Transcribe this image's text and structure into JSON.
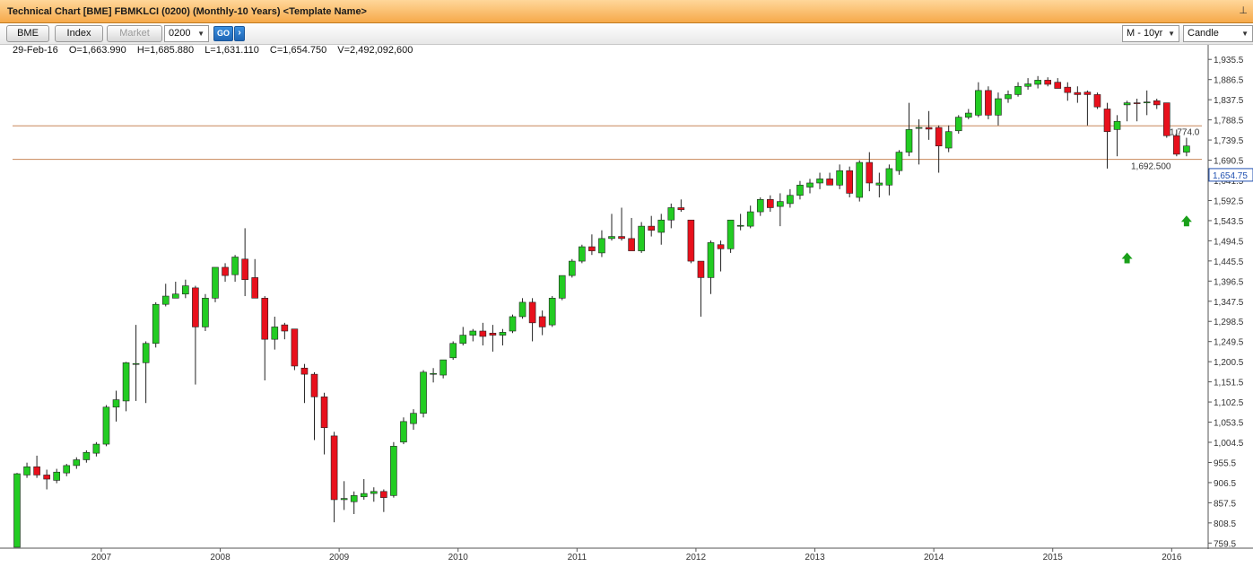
{
  "window": {
    "title": "Technical Chart [BME] FBMKLCI (0200) (Monthly-10 Years) <Template Name>",
    "pin_icon": "pin-icon"
  },
  "toolbar": {
    "bme_label": "BME",
    "index_label": "Index",
    "market_label": "Market",
    "code_value": "0200",
    "go_label": "GO",
    "next_label": "›",
    "period_value": "M - 10yr",
    "chart_type_value": "Candle"
  },
  "ohlc": {
    "date": "29-Feb-16",
    "open": "O=1,663.990",
    "high": "H=1,685.880",
    "low": "L=1,631.110",
    "close": "C=1,654.750",
    "volume": "V=2,492,092,600"
  },
  "colors": {
    "up": "#22cc22",
    "down": "#e8101c",
    "hline": "#c8875a",
    "arrow": "#1aa01a"
  },
  "chart_data": {
    "type": "candlestick",
    "interval": "monthly",
    "x_labels": [
      "2007",
      "2008",
      "2009",
      "2010",
      "2011",
      "2012",
      "2013",
      "2014",
      "2015",
      "2016"
    ],
    "y_ticks": [
      "1,935.5",
      "1,886.5",
      "1,837.5",
      "1,788.5",
      "1,739.5",
      "1,690.5",
      "1,641.5",
      "1,592.5",
      "1,543.5",
      "1,494.5",
      "1,445.5",
      "1,396.5",
      "1,347.5",
      "1,298.5",
      "1,249.5",
      "1,200.5",
      "1,151.5",
      "1,102.5",
      "1,053.5",
      "1,004.5",
      "955.5",
      "906.5",
      "857.5",
      "808.5",
      "759.5"
    ],
    "ylim": [
      710,
      1960
    ],
    "price_label": "1,654.75",
    "horizontal_lines": [
      {
        "value": 1774.0,
        "label": "1,774.0"
      },
      {
        "value": 1692.5,
        "label": "1,692.500"
      }
    ],
    "arrows": [
      {
        "date": "2015-08",
        "value": 1455,
        "direction": "up"
      },
      {
        "date": "2016-02",
        "value": 1545,
        "direction": "up"
      }
    ],
    "candles": [
      {
        "d": "2006-04",
        "o": 715,
        "h": 930,
        "l": 710,
        "c": 928
      },
      {
        "d": "2006-05",
        "o": 925,
        "h": 955,
        "l": 918,
        "c": 945
      },
      {
        "d": "2006-06",
        "o": 945,
        "h": 972,
        "l": 918,
        "c": 925
      },
      {
        "d": "2006-07",
        "o": 925,
        "h": 938,
        "l": 890,
        "c": 915
      },
      {
        "d": "2006-08",
        "o": 912,
        "h": 940,
        "l": 905,
        "c": 932
      },
      {
        "d": "2006-09",
        "o": 930,
        "h": 952,
        "l": 922,
        "c": 948
      },
      {
        "d": "2006-10",
        "o": 948,
        "h": 968,
        "l": 940,
        "c": 962
      },
      {
        "d": "2006-11",
        "o": 962,
        "h": 985,
        "l": 955,
        "c": 980
      },
      {
        "d": "2006-12",
        "o": 978,
        "h": 1005,
        "l": 970,
        "c": 1000
      },
      {
        "d": "2007-01",
        "o": 1000,
        "h": 1095,
        "l": 995,
        "c": 1090
      },
      {
        "d": "2007-02",
        "o": 1090,
        "h": 1130,
        "l": 1055,
        "c": 1108
      },
      {
        "d": "2007-03",
        "o": 1105,
        "h": 1200,
        "l": 1080,
        "c": 1198
      },
      {
        "d": "2007-04",
        "o": 1196,
        "h": 1290,
        "l": 1105,
        "c": 1196
      },
      {
        "d": "2007-05",
        "o": 1198,
        "h": 1250,
        "l": 1100,
        "c": 1245
      },
      {
        "d": "2007-06",
        "o": 1245,
        "h": 1345,
        "l": 1235,
        "c": 1340
      },
      {
        "d": "2007-07",
        "o": 1340,
        "h": 1390,
        "l": 1335,
        "c": 1360
      },
      {
        "d": "2007-08",
        "o": 1355,
        "h": 1395,
        "l": 1355,
        "c": 1365
      },
      {
        "d": "2007-09",
        "o": 1365,
        "h": 1400,
        "l": 1355,
        "c": 1385
      },
      {
        "d": "2007-10",
        "o": 1380,
        "h": 1385,
        "l": 1145,
        "c": 1285
      },
      {
        "d": "2007-11",
        "o": 1285,
        "h": 1365,
        "l": 1275,
        "c": 1355
      },
      {
        "d": "2007-12",
        "o": 1355,
        "h": 1430,
        "l": 1345,
        "c": 1430
      },
      {
        "d": "2008-01",
        "o": 1430,
        "h": 1440,
        "l": 1395,
        "c": 1410
      },
      {
        "d": "2008-02",
        "o": 1412,
        "h": 1460,
        "l": 1395,
        "c": 1455
      },
      {
        "d": "2008-03",
        "o": 1450,
        "h": 1525,
        "l": 1360,
        "c": 1400
      },
      {
        "d": "2008-04",
        "o": 1405,
        "h": 1450,
        "l": 1375,
        "c": 1355
      },
      {
        "d": "2008-05",
        "o": 1355,
        "h": 1360,
        "l": 1155,
        "c": 1255
      },
      {
        "d": "2008-06",
        "o": 1255,
        "h": 1310,
        "l": 1230,
        "c": 1285
      },
      {
        "d": "2008-07",
        "o": 1290,
        "h": 1295,
        "l": 1255,
        "c": 1275
      },
      {
        "d": "2008-08",
        "o": 1280,
        "h": 1275,
        "l": 1180,
        "c": 1190
      },
      {
        "d": "2008-09",
        "o": 1185,
        "h": 1195,
        "l": 1100,
        "c": 1170
      },
      {
        "d": "2008-10",
        "o": 1170,
        "h": 1175,
        "l": 1010,
        "c": 1115
      },
      {
        "d": "2008-11",
        "o": 1115,
        "h": 1125,
        "l": 975,
        "c": 1040
      },
      {
        "d": "2008-12",
        "o": 1020,
        "h": 1030,
        "l": 810,
        "c": 865
      },
      {
        "d": "2009-01",
        "o": 865,
        "h": 910,
        "l": 840,
        "c": 868
      },
      {
        "d": "2009-02",
        "o": 860,
        "h": 885,
        "l": 830,
        "c": 875
      },
      {
        "d": "2009-03",
        "o": 872,
        "h": 915,
        "l": 865,
        "c": 880
      },
      {
        "d": "2009-04",
        "o": 880,
        "h": 895,
        "l": 860,
        "c": 885
      },
      {
        "d": "2009-05",
        "o": 885,
        "h": 890,
        "l": 835,
        "c": 870
      },
      {
        "d": "2009-06",
        "o": 875,
        "h": 1005,
        "l": 870,
        "c": 995
      },
      {
        "d": "2009-07",
        "o": 1005,
        "h": 1065,
        "l": 1000,
        "c": 1055
      },
      {
        "d": "2009-08",
        "o": 1050,
        "h": 1085,
        "l": 1035,
        "c": 1075
      },
      {
        "d": "2009-09",
        "o": 1075,
        "h": 1180,
        "l": 1065,
        "c": 1175
      },
      {
        "d": "2009-10",
        "o": 1170,
        "h": 1185,
        "l": 1150,
        "c": 1172
      },
      {
        "d": "2009-11",
        "o": 1168,
        "h": 1205,
        "l": 1160,
        "c": 1205
      },
      {
        "d": "2009-12",
        "o": 1210,
        "h": 1250,
        "l": 1205,
        "c": 1245
      },
      {
        "d": "2010-01",
        "o": 1245,
        "h": 1285,
        "l": 1240,
        "c": 1265
      },
      {
        "d": "2010-02",
        "o": 1265,
        "h": 1280,
        "l": 1250,
        "c": 1275
      },
      {
        "d": "2010-03",
        "o": 1275,
        "h": 1295,
        "l": 1240,
        "c": 1262
      },
      {
        "d": "2010-04",
        "o": 1270,
        "h": 1290,
        "l": 1225,
        "c": 1265
      },
      {
        "d": "2010-05",
        "o": 1265,
        "h": 1280,
        "l": 1240,
        "c": 1272
      },
      {
        "d": "2010-06",
        "o": 1275,
        "h": 1315,
        "l": 1270,
        "c": 1310
      },
      {
        "d": "2010-07",
        "o": 1310,
        "h": 1355,
        "l": 1305,
        "c": 1345
      },
      {
        "d": "2010-08",
        "o": 1345,
        "h": 1355,
        "l": 1250,
        "c": 1295
      },
      {
        "d": "2010-09",
        "o": 1310,
        "h": 1325,
        "l": 1265,
        "c": 1285
      },
      {
        "d": "2010-10",
        "o": 1290,
        "h": 1360,
        "l": 1285,
        "c": 1355
      },
      {
        "d": "2010-11",
        "o": 1355,
        "h": 1410,
        "l": 1350,
        "c": 1410
      },
      {
        "d": "2010-12",
        "o": 1410,
        "h": 1450,
        "l": 1405,
        "c": 1445
      },
      {
        "d": "2011-01",
        "o": 1445,
        "h": 1485,
        "l": 1440,
        "c": 1480
      },
      {
        "d": "2011-02",
        "o": 1480,
        "h": 1510,
        "l": 1460,
        "c": 1470
      },
      {
        "d": "2011-03",
        "o": 1465,
        "h": 1520,
        "l": 1455,
        "c": 1500
      },
      {
        "d": "2011-04",
        "o": 1500,
        "h": 1560,
        "l": 1495,
        "c": 1505
      },
      {
        "d": "2011-05",
        "o": 1505,
        "h": 1575,
        "l": 1495,
        "c": 1500
      },
      {
        "d": "2011-06",
        "o": 1500,
        "h": 1550,
        "l": 1475,
        "c": 1470
      },
      {
        "d": "2011-07",
        "o": 1470,
        "h": 1540,
        "l": 1465,
        "c": 1530
      },
      {
        "d": "2011-08",
        "o": 1530,
        "h": 1555,
        "l": 1505,
        "c": 1520
      },
      {
        "d": "2011-09",
        "o": 1515,
        "h": 1560,
        "l": 1485,
        "c": 1545
      },
      {
        "d": "2011-10",
        "o": 1545,
        "h": 1585,
        "l": 1525,
        "c": 1575
      },
      {
        "d": "2011-11",
        "o": 1575,
        "h": 1595,
        "l": 1565,
        "c": 1570
      },
      {
        "d": "2011-12",
        "o": 1545,
        "h": 1545,
        "l": 1440,
        "c": 1445
      },
      {
        "d": "2012-01",
        "o": 1445,
        "h": 1445,
        "l": 1310,
        "c": 1405
      },
      {
        "d": "2012-02",
        "o": 1405,
        "h": 1495,
        "l": 1365,
        "c": 1490
      },
      {
        "d": "2012-03",
        "o": 1485,
        "h": 1495,
        "l": 1420,
        "c": 1475
      },
      {
        "d": "2012-04",
        "o": 1475,
        "h": 1545,
        "l": 1465,
        "c": 1545
      },
      {
        "d": "2012-05",
        "o": 1530,
        "h": 1560,
        "l": 1520,
        "c": 1532
      },
      {
        "d": "2012-06",
        "o": 1530,
        "h": 1580,
        "l": 1525,
        "c": 1565
      },
      {
        "d": "2012-07",
        "o": 1565,
        "h": 1600,
        "l": 1555,
        "c": 1595
      },
      {
        "d": "2012-08",
        "o": 1595,
        "h": 1605,
        "l": 1565,
        "c": 1575
      },
      {
        "d": "2012-09",
        "o": 1578,
        "h": 1610,
        "l": 1530,
        "c": 1590
      },
      {
        "d": "2012-10",
        "o": 1585,
        "h": 1620,
        "l": 1575,
        "c": 1605
      },
      {
        "d": "2012-11",
        "o": 1605,
        "h": 1640,
        "l": 1595,
        "c": 1630
      },
      {
        "d": "2012-12",
        "o": 1625,
        "h": 1645,
        "l": 1610,
        "c": 1635
      },
      {
        "d": "2013-01",
        "o": 1635,
        "h": 1660,
        "l": 1620,
        "c": 1645
      },
      {
        "d": "2013-02",
        "o": 1645,
        "h": 1660,
        "l": 1635,
        "c": 1630
      },
      {
        "d": "2013-03",
        "o": 1630,
        "h": 1680,
        "l": 1620,
        "c": 1665
      },
      {
        "d": "2013-04",
        "o": 1665,
        "h": 1675,
        "l": 1600,
        "c": 1610
      },
      {
        "d": "2013-05",
        "o": 1600,
        "h": 1690,
        "l": 1590,
        "c": 1685
      },
      {
        "d": "2013-06",
        "o": 1685,
        "h": 1710,
        "l": 1615,
        "c": 1635
      },
      {
        "d": "2013-07",
        "o": 1630,
        "h": 1660,
        "l": 1600,
        "c": 1635
      },
      {
        "d": "2013-08",
        "o": 1630,
        "h": 1680,
        "l": 1605,
        "c": 1670
      },
      {
        "d": "2013-09",
        "o": 1665,
        "h": 1715,
        "l": 1655,
        "c": 1710
      },
      {
        "d": "2013-10",
        "o": 1710,
        "h": 1830,
        "l": 1700,
        "c": 1765
      },
      {
        "d": "2013-11",
        "o": 1770,
        "h": 1790,
        "l": 1680,
        "c": 1770
      },
      {
        "d": "2013-12",
        "o": 1770,
        "h": 1810,
        "l": 1740,
        "c": 1766
      },
      {
        "d": "2014-01",
        "o": 1770,
        "h": 1775,
        "l": 1660,
        "c": 1725
      },
      {
        "d": "2014-02",
        "o": 1720,
        "h": 1775,
        "l": 1710,
        "c": 1760
      },
      {
        "d": "2014-03",
        "o": 1762,
        "h": 1800,
        "l": 1755,
        "c": 1795
      },
      {
        "d": "2014-04",
        "o": 1795,
        "h": 1815,
        "l": 1790,
        "c": 1805
      },
      {
        "d": "2014-05",
        "o": 1800,
        "h": 1880,
        "l": 1795,
        "c": 1860
      },
      {
        "d": "2014-06",
        "o": 1860,
        "h": 1870,
        "l": 1790,
        "c": 1800
      },
      {
        "d": "2014-07",
        "o": 1800,
        "h": 1855,
        "l": 1775,
        "c": 1840
      },
      {
        "d": "2014-08",
        "o": 1840,
        "h": 1860,
        "l": 1830,
        "c": 1850
      },
      {
        "d": "2014-09",
        "o": 1850,
        "h": 1880,
        "l": 1845,
        "c": 1870
      },
      {
        "d": "2014-10",
        "o": 1870,
        "h": 1890,
        "l": 1862,
        "c": 1876
      },
      {
        "d": "2014-11",
        "o": 1875,
        "h": 1895,
        "l": 1865,
        "c": 1885
      },
      {
        "d": "2014-12",
        "o": 1885,
        "h": 1892,
        "l": 1870,
        "c": 1875
      },
      {
        "d": "2015-01",
        "o": 1880,
        "h": 1890,
        "l": 1865,
        "c": 1865
      },
      {
        "d": "2015-02",
        "o": 1868,
        "h": 1880,
        "l": 1835,
        "c": 1855
      },
      {
        "d": "2015-03",
        "o": 1855,
        "h": 1870,
        "l": 1830,
        "c": 1850
      },
      {
        "d": "2015-04",
        "o": 1856,
        "h": 1860,
        "l": 1775,
        "c": 1850
      },
      {
        "d": "2015-05",
        "o": 1850,
        "h": 1855,
        "l": 1815,
        "c": 1820
      },
      {
        "d": "2015-06",
        "o": 1815,
        "h": 1830,
        "l": 1670,
        "c": 1760
      },
      {
        "d": "2015-07",
        "o": 1765,
        "h": 1800,
        "l": 1700,
        "c": 1785
      },
      {
        "d": "2015-08",
        "o": 1825,
        "h": 1835,
        "l": 1785,
        "c": 1830
      },
      {
        "d": "2015-09",
        "o": 1830,
        "h": 1840,
        "l": 1785,
        "c": 1828
      },
      {
        "d": "2015-10",
        "o": 1832,
        "h": 1860,
        "l": 1800,
        "c": 1832
      },
      {
        "d": "2015-11",
        "o": 1835,
        "h": 1840,
        "l": 1815,
        "c": 1825
      },
      {
        "d": "2015-12",
        "o": 1830,
        "h": 1830,
        "l": 1745,
        "c": 1750
      },
      {
        "d": "2016-01",
        "o": 1750,
        "h": 1765,
        "l": 1700,
        "c": 1705
      },
      {
        "d": "2016-02",
        "o": 1710,
        "h": 1745,
        "l": 1700,
        "c": 1725
      }
    ]
  }
}
